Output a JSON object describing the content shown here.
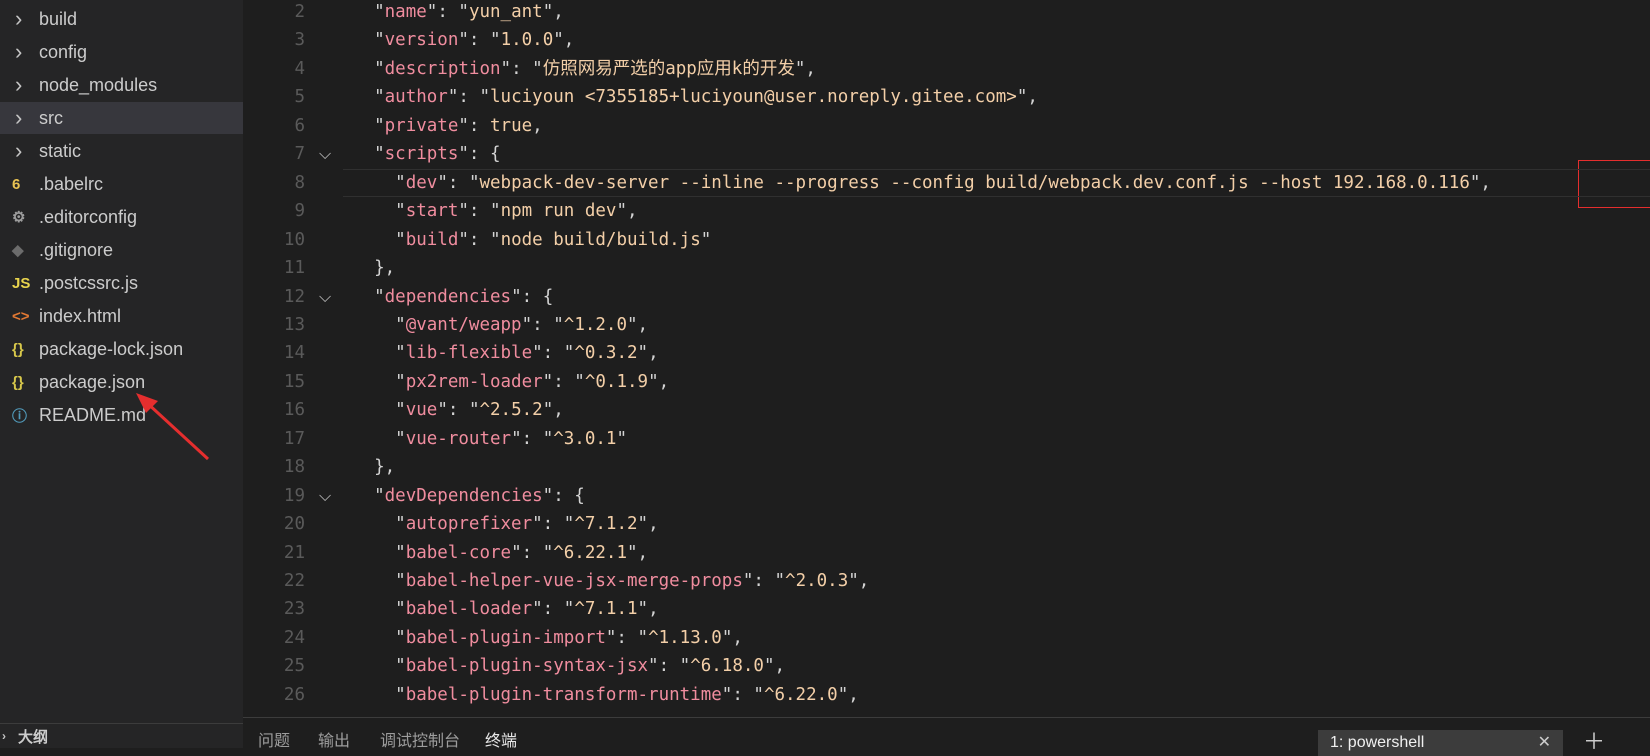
{
  "sidebar": {
    "items": [
      {
        "label": "build",
        "icon": "chevron-right-icon",
        "glyph": "›",
        "kind": "folder"
      },
      {
        "label": "config",
        "icon": "chevron-right-icon",
        "glyph": "›",
        "kind": "folder"
      },
      {
        "label": "node_modules",
        "icon": "chevron-right-icon",
        "glyph": "›",
        "kind": "folder"
      },
      {
        "label": "src",
        "icon": "chevron-right-icon",
        "glyph": "›",
        "kind": "folder",
        "selected": true
      },
      {
        "label": "static",
        "icon": "chevron-right-icon",
        "glyph": "›",
        "kind": "folder"
      },
      {
        "label": ".babelrc",
        "icon": "babel-file-icon",
        "glyph": "6",
        "color": "#e8c252"
      },
      {
        "label": ".editorconfig",
        "icon": "gear-file-icon",
        "glyph": "⚙",
        "color": "#9c9c9c"
      },
      {
        "label": ".gitignore",
        "icon": "git-file-icon",
        "glyph": "◆",
        "color": "#6c6c6c"
      },
      {
        "label": ".postcssrc.js",
        "icon": "javascript-file-icon",
        "glyph": "JS",
        "color": "#e8d44d"
      },
      {
        "label": "index.html",
        "icon": "html-file-icon",
        "glyph": "<>",
        "color": "#e37933"
      },
      {
        "label": "package-lock.json",
        "icon": "json-file-icon",
        "glyph": "{}",
        "color": "#d8c84b"
      },
      {
        "label": "package.json",
        "icon": "json-file-icon",
        "glyph": "{}",
        "color": "#d8c84b"
      },
      {
        "label": "README.md",
        "icon": "info-file-icon",
        "glyph": "ⓘ",
        "color": "#519aba"
      }
    ],
    "outline_label": "大纲",
    "outline_icon": "chevron-right-icon"
  },
  "editor": {
    "lines": [
      {
        "n": "2",
        "text": "  \"name\": \"yun_ant\","
      },
      {
        "n": "3",
        "text": "  \"version\": \"1.0.0\","
      },
      {
        "n": "4",
        "text": "  \"description\": \"仿照网易严选的app应用k的开发\","
      },
      {
        "n": "5",
        "text": "  \"author\": \"luciyoun <7355185+luciyoun@user.noreply.gitee.com>\","
      },
      {
        "n": "6",
        "text": "  \"private\": true,"
      },
      {
        "n": "7",
        "text": "  \"scripts\": {",
        "fold": true
      },
      {
        "n": "8",
        "text": "    \"dev\": \"webpack-dev-server --inline --progress --config build/webpack.dev.conf.js --host 192.168.0.116\",",
        "current": true
      },
      {
        "n": "9",
        "text": "    \"start\": \"npm run dev\","
      },
      {
        "n": "10",
        "text": "    \"build\": \"node build/build.js\""
      },
      {
        "n": "11",
        "text": "  },"
      },
      {
        "n": "12",
        "text": "  \"dependencies\": {",
        "fold": true
      },
      {
        "n": "13",
        "text": "    \"@vant/weapp\": \"^1.2.0\","
      },
      {
        "n": "14",
        "text": "    \"lib-flexible\": \"^0.3.2\","
      },
      {
        "n": "15",
        "text": "    \"px2rem-loader\": \"^0.1.9\","
      },
      {
        "n": "16",
        "text": "    \"vue\": \"^2.5.2\","
      },
      {
        "n": "17",
        "text": "    \"vue-router\": \"^3.0.1\""
      },
      {
        "n": "18",
        "text": "  },"
      },
      {
        "n": "19",
        "text": "  \"devDependencies\": {",
        "fold": true
      },
      {
        "n": "20",
        "text": "    \"autoprefixer\": \"^7.1.2\","
      },
      {
        "n": "21",
        "text": "    \"babel-core\": \"^6.22.1\","
      },
      {
        "n": "22",
        "text": "    \"babel-helper-vue-jsx-merge-props\": \"^2.0.3\","
      },
      {
        "n": "23",
        "text": "    \"babel-loader\": \"^7.1.1\","
      },
      {
        "n": "24",
        "text": "    \"babel-plugin-import\": \"^1.13.0\","
      },
      {
        "n": "25",
        "text": "    \"babel-plugin-syntax-jsx\": \"^6.18.0\","
      },
      {
        "n": "26",
        "text": "    \"babel-plugin-transform-runtime\": \"^6.22.0\","
      }
    ],
    "fold_icon": "chevron-down-icon",
    "highlight_annotation": "--host 192.168.0.116"
  },
  "panel": {
    "tabs": [
      {
        "label": "问题"
      },
      {
        "label": "输出"
      },
      {
        "label": "调试控制台"
      },
      {
        "label": "终端",
        "active": true
      }
    ],
    "terminal_select": "1: powershell",
    "close_icon": "close-icon",
    "add_icon": "plus-icon"
  },
  "colors": {
    "annotation_red": "#e52e2e",
    "json_key": "#f08d9f",
    "json_string": "#f3cfa8"
  }
}
